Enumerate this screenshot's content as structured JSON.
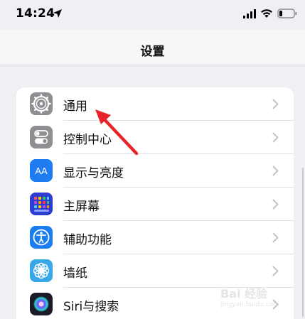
{
  "status_bar": {
    "time": "14:24"
  },
  "nav": {
    "title": "设置"
  },
  "settings": {
    "items": [
      {
        "label": "通用",
        "icon": "gear-icon",
        "color": "#8e8e93"
      },
      {
        "label": "控制中心",
        "icon": "toggle-icon",
        "color": "#8e8e93"
      },
      {
        "label": "显示与亮度",
        "icon": "text-size-icon",
        "color": "#1f7bf2"
      },
      {
        "label": "主屏幕",
        "icon": "app-grid-icon",
        "color": "#2c3dd1"
      },
      {
        "label": "辅助功能",
        "icon": "accessibility-icon",
        "color": "#1a7ef0"
      },
      {
        "label": "墙纸",
        "icon": "flower-icon",
        "color": "#37a7e8"
      },
      {
        "label": "Siri与搜索",
        "icon": "siri-icon",
        "color": "#1b1b2a"
      }
    ]
  },
  "icon_texts": {
    "display_glyph": "AA"
  },
  "watermark": {
    "text": "Bai 经验",
    "sub": "jingyan.baidu.com"
  }
}
